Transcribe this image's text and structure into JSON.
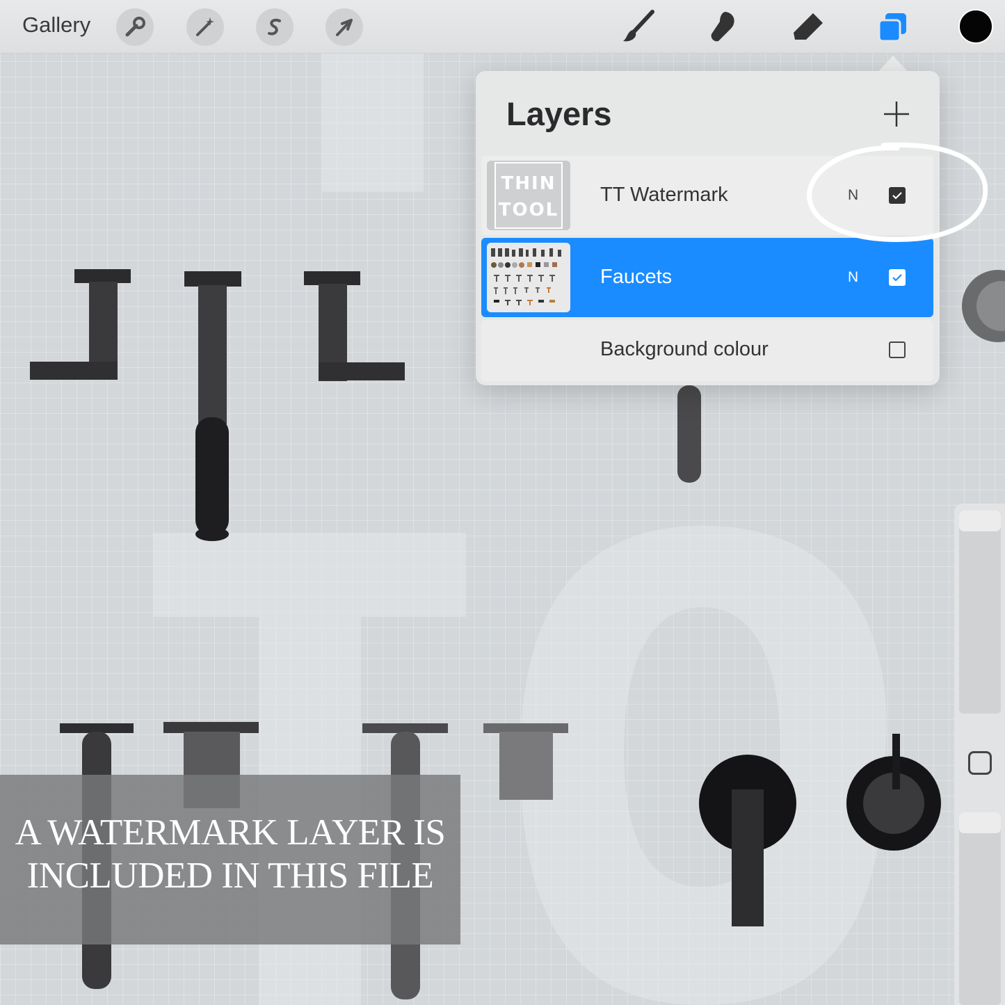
{
  "toolbar": {
    "gallery_label": "Gallery",
    "left_tools": [
      "wrench-icon",
      "magic-wand-icon",
      "selection-s-icon",
      "transform-arrow-icon"
    ],
    "right_tools": [
      "brush-icon",
      "smudge-icon",
      "eraser-icon",
      "layers-icon"
    ],
    "active_tool": "layers-icon",
    "current_color": "#050505",
    "accent_color": "#1a8cff"
  },
  "layers_panel": {
    "title": "Layers",
    "add_icon": "plus-icon",
    "layers": [
      {
        "name": "TT Watermark",
        "blend_mode": "N",
        "visible": true,
        "selected": false,
        "thumbnail_text": [
          "THIN",
          "TOOL"
        ]
      },
      {
        "name": "Faucets",
        "blend_mode": "N",
        "visible": true,
        "selected": true
      },
      {
        "name": "Background colour",
        "visible": false,
        "selected": false
      }
    ]
  },
  "annotation": {
    "banner_line1": "A WATERMARK LAYER IS",
    "banner_line2": "INCLUDED IN THIS FILE"
  },
  "side_bar": {
    "icons": [
      "brush-size-slider",
      "modify-square-icon",
      "opacity-slider"
    ]
  }
}
